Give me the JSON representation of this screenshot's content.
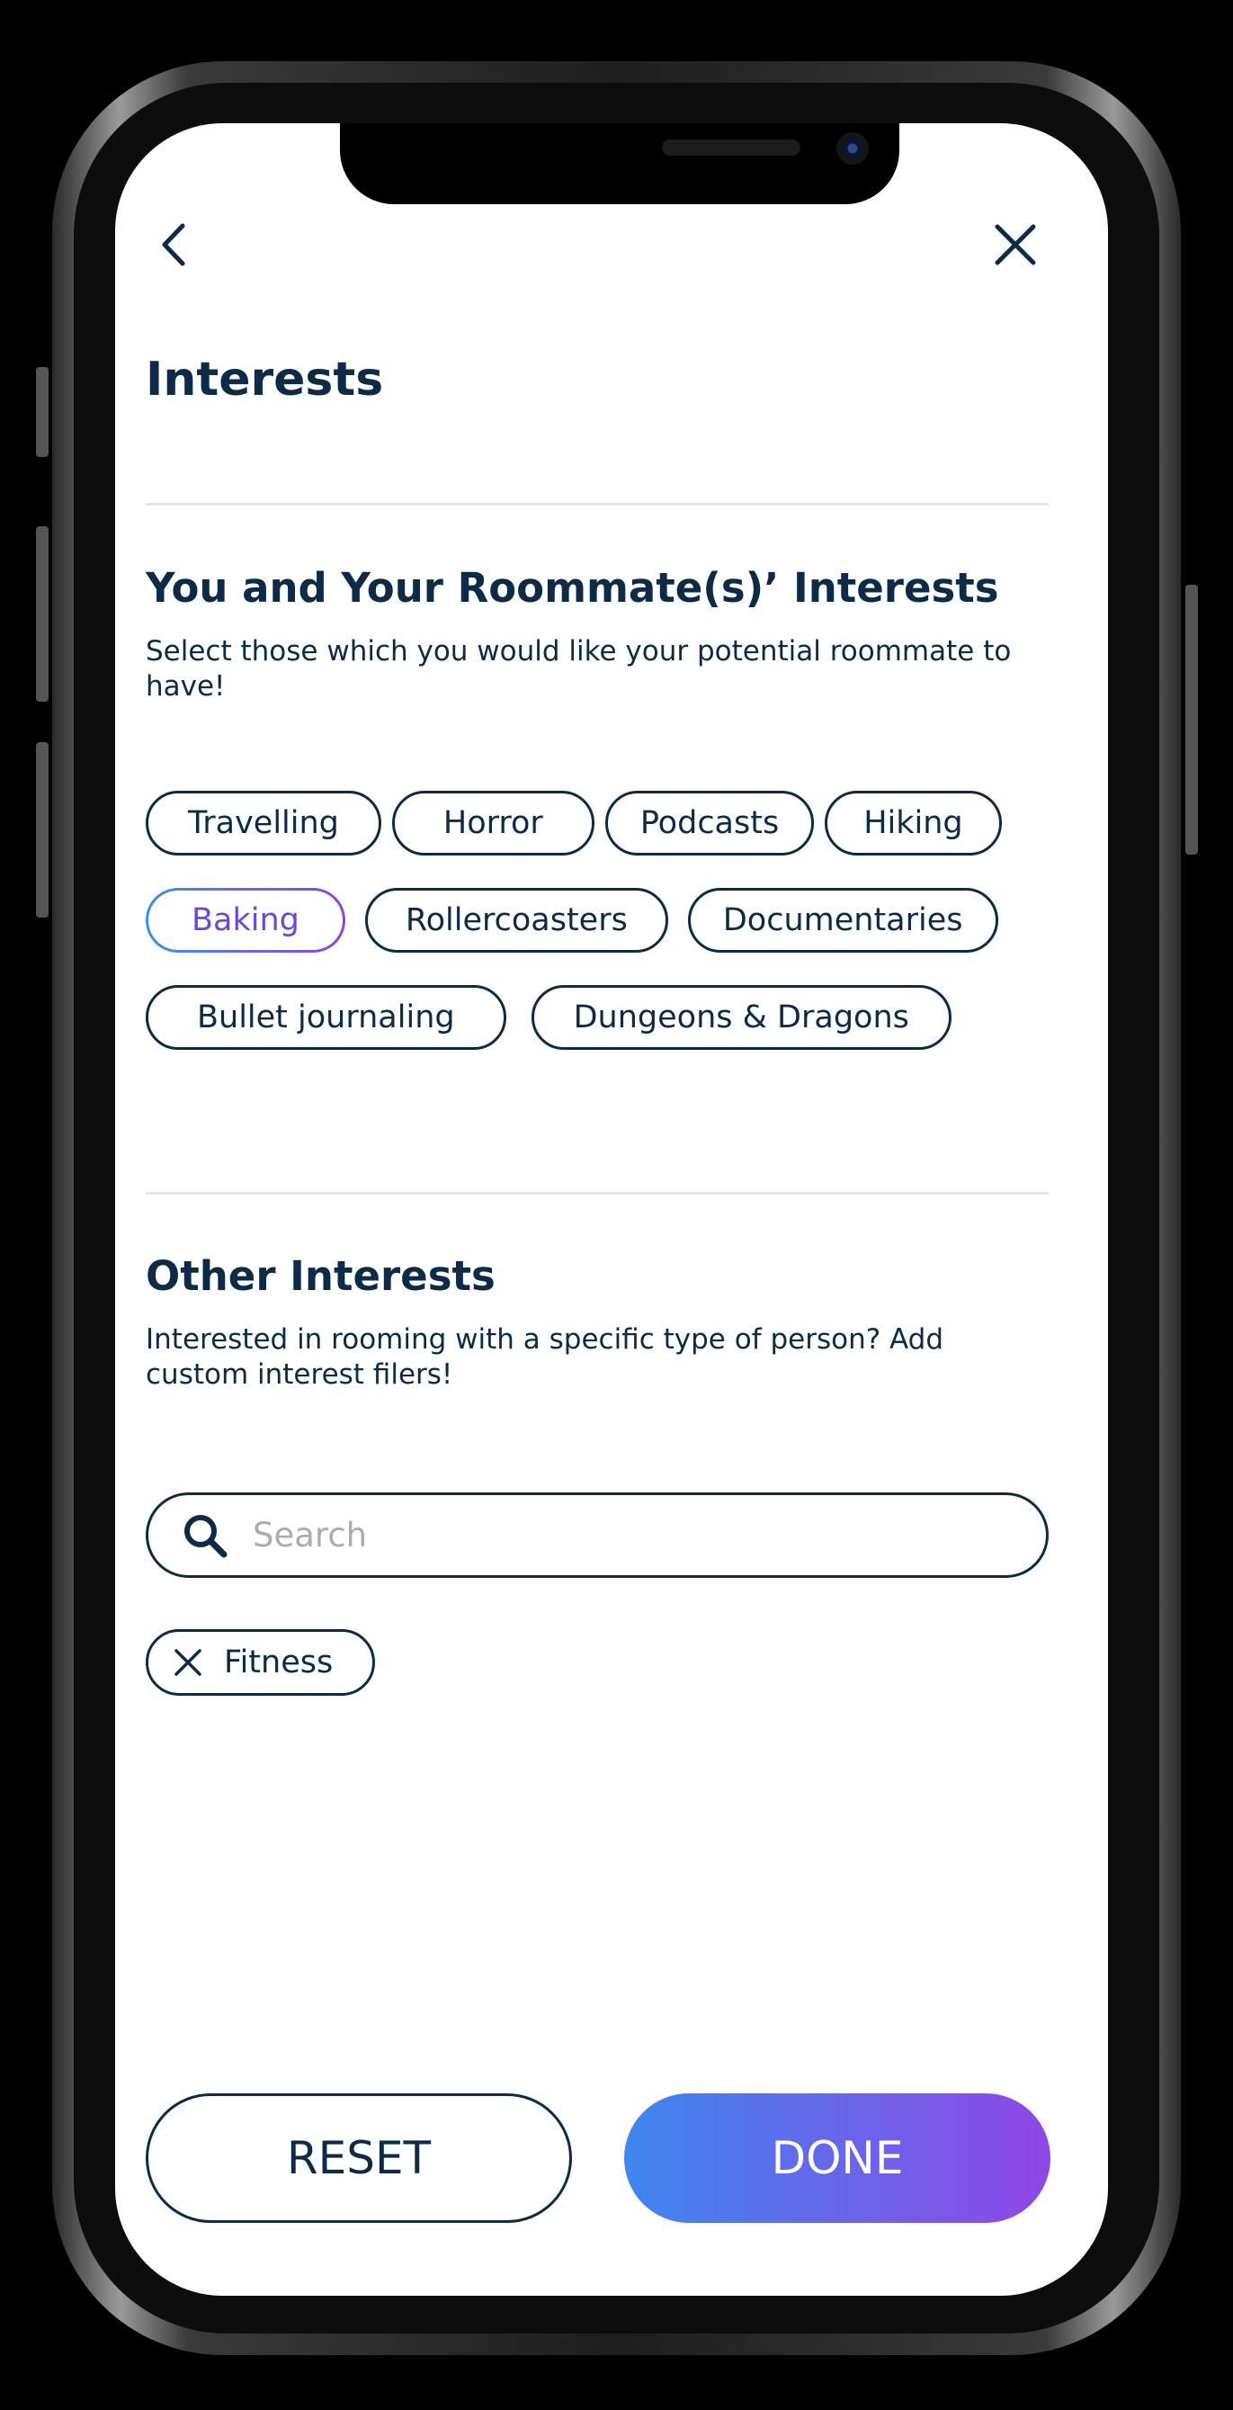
{
  "header": {
    "title": "Interests"
  },
  "roommate_section": {
    "title": "You and Your Roommate(s)’ Interests",
    "subtitle": "Select those which you would like your potential roommate to have!",
    "chips": [
      {
        "label": "Travelling",
        "selected": false
      },
      {
        "label": "Horror",
        "selected": false
      },
      {
        "label": "Podcasts",
        "selected": false
      },
      {
        "label": "Hiking",
        "selected": false
      },
      {
        "label": "Baking",
        "selected": true
      },
      {
        "label": "Rollercoasters",
        "selected": false
      },
      {
        "label": "Documentaries",
        "selected": false
      },
      {
        "label": "Bullet journaling",
        "selected": false
      },
      {
        "label": "Dungeons & Dragons",
        "selected": false
      }
    ]
  },
  "other_section": {
    "title": "Other Interests",
    "subtitle": "Interested in rooming with a specific type of person? Add custom interest filers!",
    "search": {
      "placeholder": "Search",
      "value": ""
    },
    "tags": [
      {
        "label": "Fitness"
      }
    ]
  },
  "footer": {
    "reset_label": "RESET",
    "done_label": "DONE"
  },
  "colors": {
    "text": "#0d2b47",
    "selected_text": "#6e46d8",
    "gradient_start": "#3f86ef",
    "gradient_end": "#8f47e6"
  },
  "icons": {
    "back": "chevron-left-icon",
    "close": "close-icon",
    "search": "search-icon",
    "remove_tag": "x-icon"
  }
}
